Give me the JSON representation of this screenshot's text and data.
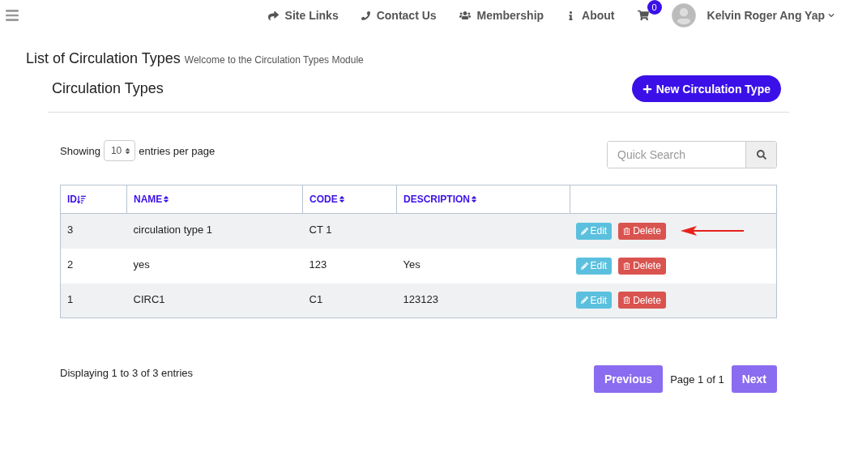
{
  "nav": {
    "links": [
      {
        "kind": "share",
        "label": "Site Links"
      },
      {
        "kind": "phone",
        "label": "Contact Us"
      },
      {
        "kind": "users",
        "label": "Membership"
      },
      {
        "kind": "info",
        "label": "About"
      }
    ],
    "cart_count": "0",
    "user": "Kelvin Roger Ang Yap"
  },
  "page": {
    "title": "List of Circulation Types",
    "subtitle": "Welcome to the Circulation Types Module"
  },
  "card": {
    "title": "Circulation Types",
    "new_button": "New Circulation Type"
  },
  "controls": {
    "showing": "Showing",
    "per_page": "10",
    "entries_label": "entries per page",
    "search": {
      "placeholder": "Quick Search"
    }
  },
  "table": {
    "columns": [
      {
        "label": "ID",
        "sorted": true
      },
      {
        "label": "NAME",
        "sorted": false
      },
      {
        "label": "CODE",
        "sorted": false
      },
      {
        "label": "DESCRIPTION",
        "sorted": false
      }
    ],
    "rows": [
      {
        "cells": [
          "3",
          "circulation type 1",
          "CT 1",
          ""
        ],
        "edit": "Edit",
        "delete": "Delete",
        "annotated": true
      },
      {
        "cells": [
          "2",
          "yes",
          "123",
          "Yes"
        ],
        "edit": "Edit",
        "delete": "Delete",
        "annotated": false
      },
      {
        "cells": [
          "1",
          "CIRC1",
          "C1",
          "123123"
        ],
        "edit": "Edit",
        "delete": "Delete",
        "annotated": false
      }
    ]
  },
  "footer": {
    "summary": "Displaying 1 to 3 of 3 entries",
    "previous": "Previous",
    "page": "Page 1 of 1",
    "next": "Next"
  }
}
